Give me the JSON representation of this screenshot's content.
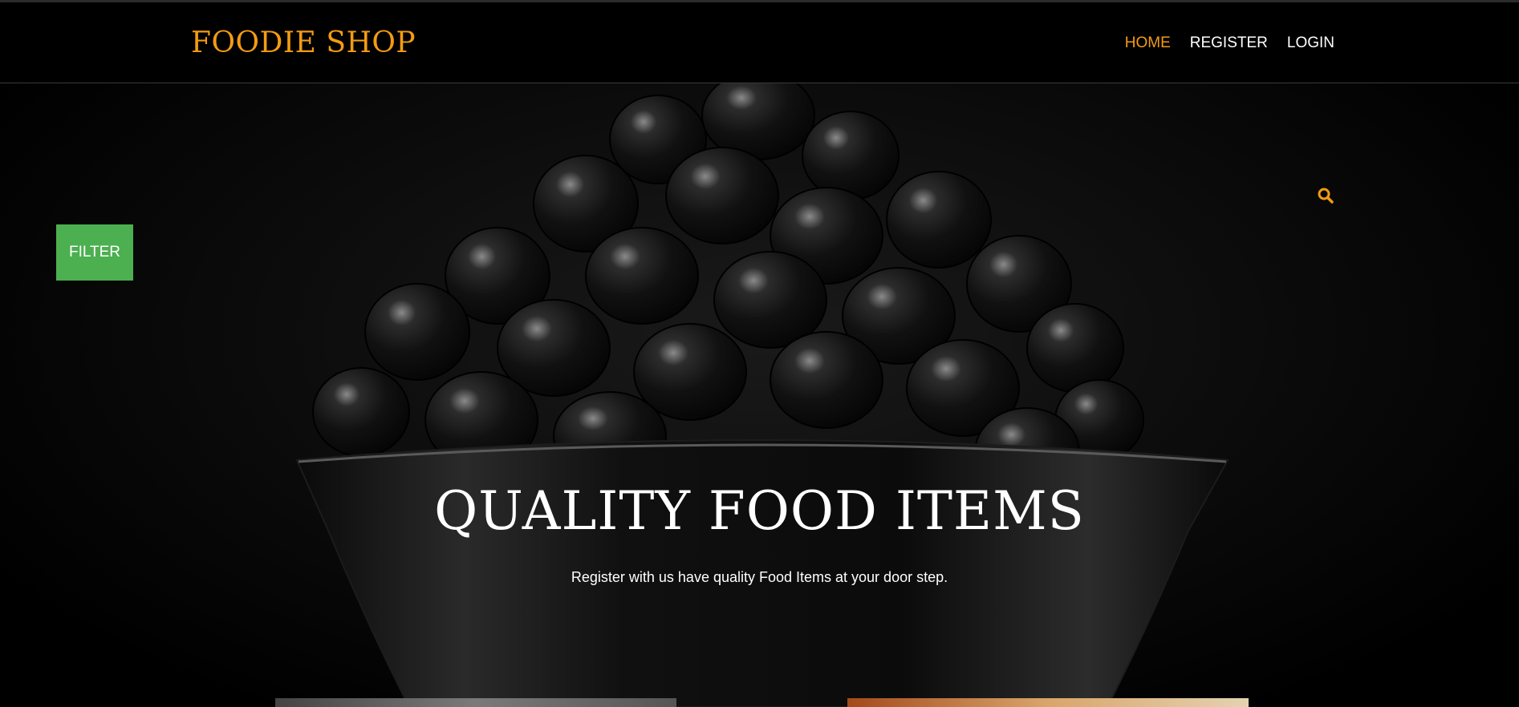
{
  "header": {
    "brand": "FOODIE SHOP",
    "nav": [
      {
        "label": "HOME",
        "active": true
      },
      {
        "label": "REGISTER",
        "active": false
      },
      {
        "label": "LOGIN",
        "active": false
      }
    ]
  },
  "hero": {
    "title": "QUALITY FOOD ITEMS",
    "subtitle": "Register with us have quality Food Items at your door step.",
    "search_icon": "search-icon"
  },
  "filter": {
    "label": "FILTER"
  },
  "colors": {
    "accent": "#f39c12",
    "filter_bg": "#4caf50",
    "background": "#000000"
  }
}
